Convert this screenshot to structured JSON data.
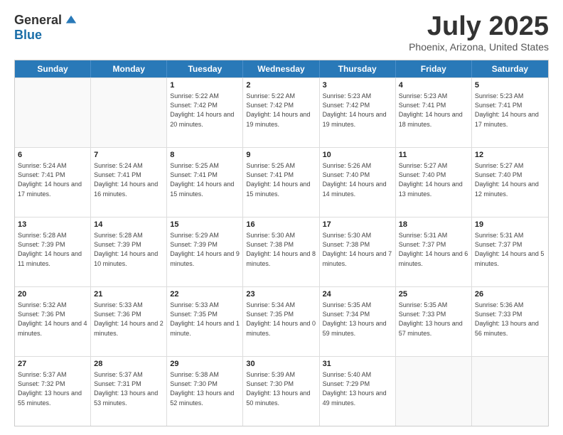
{
  "logo": {
    "general": "General",
    "blue": "Blue"
  },
  "header": {
    "month": "July 2025",
    "location": "Phoenix, Arizona, United States"
  },
  "weekdays": [
    "Sunday",
    "Monday",
    "Tuesday",
    "Wednesday",
    "Thursday",
    "Friday",
    "Saturday"
  ],
  "rows": [
    [
      {
        "day": "",
        "info": ""
      },
      {
        "day": "",
        "info": ""
      },
      {
        "day": "1",
        "info": "Sunrise: 5:22 AM\nSunset: 7:42 PM\nDaylight: 14 hours and 20 minutes."
      },
      {
        "day": "2",
        "info": "Sunrise: 5:22 AM\nSunset: 7:42 PM\nDaylight: 14 hours and 19 minutes."
      },
      {
        "day": "3",
        "info": "Sunrise: 5:23 AM\nSunset: 7:42 PM\nDaylight: 14 hours and 19 minutes."
      },
      {
        "day": "4",
        "info": "Sunrise: 5:23 AM\nSunset: 7:41 PM\nDaylight: 14 hours and 18 minutes."
      },
      {
        "day": "5",
        "info": "Sunrise: 5:23 AM\nSunset: 7:41 PM\nDaylight: 14 hours and 17 minutes."
      }
    ],
    [
      {
        "day": "6",
        "info": "Sunrise: 5:24 AM\nSunset: 7:41 PM\nDaylight: 14 hours and 17 minutes."
      },
      {
        "day": "7",
        "info": "Sunrise: 5:24 AM\nSunset: 7:41 PM\nDaylight: 14 hours and 16 minutes."
      },
      {
        "day": "8",
        "info": "Sunrise: 5:25 AM\nSunset: 7:41 PM\nDaylight: 14 hours and 15 minutes."
      },
      {
        "day": "9",
        "info": "Sunrise: 5:25 AM\nSunset: 7:41 PM\nDaylight: 14 hours and 15 minutes."
      },
      {
        "day": "10",
        "info": "Sunrise: 5:26 AM\nSunset: 7:40 PM\nDaylight: 14 hours and 14 minutes."
      },
      {
        "day": "11",
        "info": "Sunrise: 5:27 AM\nSunset: 7:40 PM\nDaylight: 14 hours and 13 minutes."
      },
      {
        "day": "12",
        "info": "Sunrise: 5:27 AM\nSunset: 7:40 PM\nDaylight: 14 hours and 12 minutes."
      }
    ],
    [
      {
        "day": "13",
        "info": "Sunrise: 5:28 AM\nSunset: 7:39 PM\nDaylight: 14 hours and 11 minutes."
      },
      {
        "day": "14",
        "info": "Sunrise: 5:28 AM\nSunset: 7:39 PM\nDaylight: 14 hours and 10 minutes."
      },
      {
        "day": "15",
        "info": "Sunrise: 5:29 AM\nSunset: 7:39 PM\nDaylight: 14 hours and 9 minutes."
      },
      {
        "day": "16",
        "info": "Sunrise: 5:30 AM\nSunset: 7:38 PM\nDaylight: 14 hours and 8 minutes."
      },
      {
        "day": "17",
        "info": "Sunrise: 5:30 AM\nSunset: 7:38 PM\nDaylight: 14 hours and 7 minutes."
      },
      {
        "day": "18",
        "info": "Sunrise: 5:31 AM\nSunset: 7:37 PM\nDaylight: 14 hours and 6 minutes."
      },
      {
        "day": "19",
        "info": "Sunrise: 5:31 AM\nSunset: 7:37 PM\nDaylight: 14 hours and 5 minutes."
      }
    ],
    [
      {
        "day": "20",
        "info": "Sunrise: 5:32 AM\nSunset: 7:36 PM\nDaylight: 14 hours and 4 minutes."
      },
      {
        "day": "21",
        "info": "Sunrise: 5:33 AM\nSunset: 7:36 PM\nDaylight: 14 hours and 2 minutes."
      },
      {
        "day": "22",
        "info": "Sunrise: 5:33 AM\nSunset: 7:35 PM\nDaylight: 14 hours and 1 minute."
      },
      {
        "day": "23",
        "info": "Sunrise: 5:34 AM\nSunset: 7:35 PM\nDaylight: 14 hours and 0 minutes."
      },
      {
        "day": "24",
        "info": "Sunrise: 5:35 AM\nSunset: 7:34 PM\nDaylight: 13 hours and 59 minutes."
      },
      {
        "day": "25",
        "info": "Sunrise: 5:35 AM\nSunset: 7:33 PM\nDaylight: 13 hours and 57 minutes."
      },
      {
        "day": "26",
        "info": "Sunrise: 5:36 AM\nSunset: 7:33 PM\nDaylight: 13 hours and 56 minutes."
      }
    ],
    [
      {
        "day": "27",
        "info": "Sunrise: 5:37 AM\nSunset: 7:32 PM\nDaylight: 13 hours and 55 minutes."
      },
      {
        "day": "28",
        "info": "Sunrise: 5:37 AM\nSunset: 7:31 PM\nDaylight: 13 hours and 53 minutes."
      },
      {
        "day": "29",
        "info": "Sunrise: 5:38 AM\nSunset: 7:30 PM\nDaylight: 13 hours and 52 minutes."
      },
      {
        "day": "30",
        "info": "Sunrise: 5:39 AM\nSunset: 7:30 PM\nDaylight: 13 hours and 50 minutes."
      },
      {
        "day": "31",
        "info": "Sunrise: 5:40 AM\nSunset: 7:29 PM\nDaylight: 13 hours and 49 minutes."
      },
      {
        "day": "",
        "info": ""
      },
      {
        "day": "",
        "info": ""
      }
    ]
  ]
}
